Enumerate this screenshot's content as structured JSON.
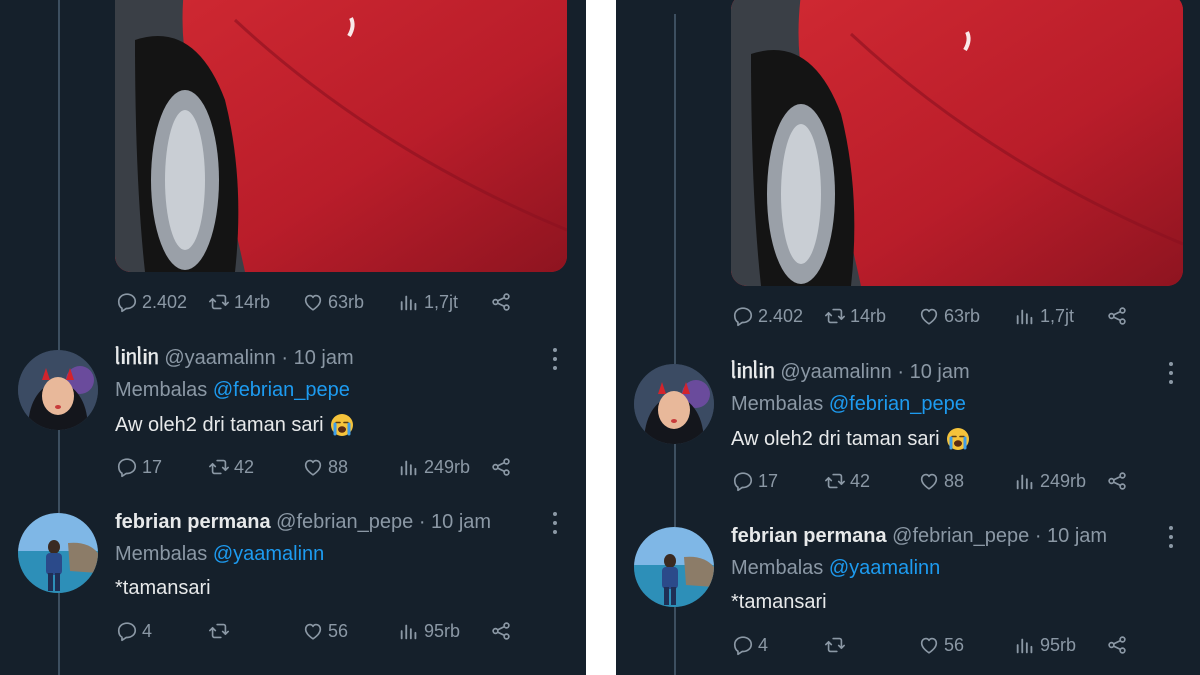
{
  "post_stats": {
    "replies": "2.402",
    "reposts": "14rb",
    "likes": "63rb",
    "views": "1,7jt"
  },
  "tweets": [
    {
      "display_name": "ᥣіᥒᥣіᥒ",
      "handle": "@yaamalinn",
      "time": "10 jam",
      "reply_prefix": "Membalas",
      "reply_to": "@febrian_pepe",
      "text": "Aw oleh2 dri taman sari",
      "emoji": "😭",
      "stats": {
        "replies": "17",
        "reposts": "42",
        "likes": "88",
        "views": "249rb"
      }
    },
    {
      "display_name": "febrian permana",
      "handle": "@febrian_pepe",
      "time": "10 jam",
      "reply_prefix": "Membalas",
      "reply_to": "@yaamalinn",
      "text": "*tamansari",
      "stats": {
        "replies": "4",
        "reposts": "",
        "likes": "56",
        "views": "95rb"
      }
    }
  ],
  "separator": "·",
  "icons": [
    "reply-icon",
    "repost-icon",
    "like-icon",
    "views-icon",
    "share-icon",
    "more-icon",
    "crying-face-emoji"
  ],
  "colors": {
    "background": "#15202b",
    "text": "#e7e9ea",
    "muted": "#8b98a5",
    "link": "#1d9bf0",
    "media_red": "#b31b28"
  }
}
